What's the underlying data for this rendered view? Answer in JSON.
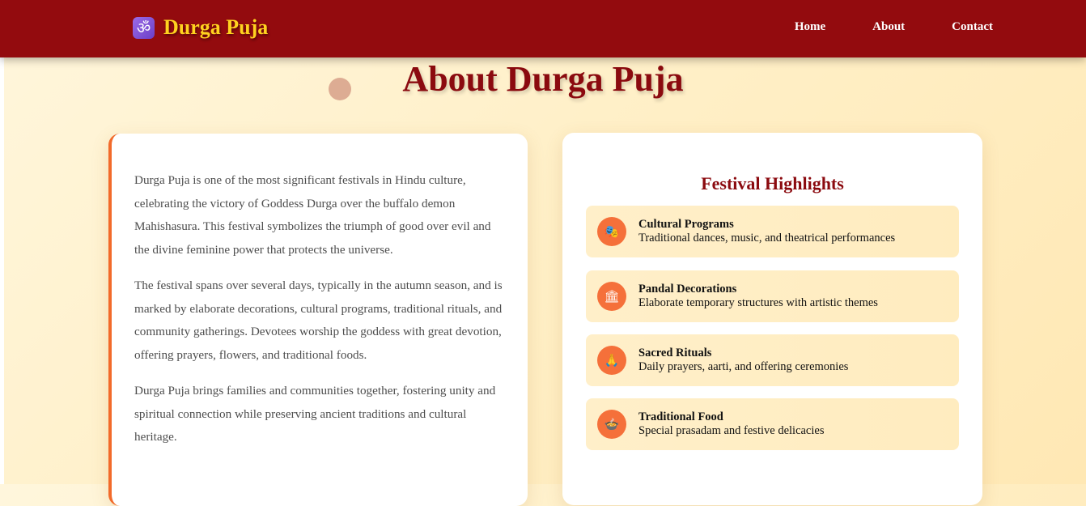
{
  "header": {
    "logo_icon": "om-symbol-icon",
    "logo_glyph": "ॐ",
    "title": "Durga Puja",
    "nav": [
      {
        "label": "Home"
      },
      {
        "label": "About"
      },
      {
        "label": "Contact"
      }
    ],
    "colors": {
      "bar": "#930b0e",
      "title": "#ffd21f"
    }
  },
  "main": {
    "title": "About Durga Puja",
    "paragraphs": [
      "Durga Puja is one of the most significant festivals in Hindu culture, celebrating the victory of Goddess Durga over the buffalo demon Mahishasura. This festival symbolizes the triumph of good over evil and the divine feminine power that protects the universe.",
      "The festival spans over several days, typically in the autumn season, and is marked by elaborate decorations, cultural programs, traditional rituals, and community gatherings. Devotees worship the goddess with great devotion, offering prayers, flowers, and traditional foods.",
      "Durga Puja brings families and communities together, fostering unity and spiritual connection while preserving ancient traditions and cultural heritage."
    ],
    "highlights": {
      "title": "Festival Highlights",
      "items": [
        {
          "icon": "theater-masks-icon",
          "glyph": "🎭",
          "name": "Cultural Programs",
          "desc": "Traditional dances, music, and theatrical performances"
        },
        {
          "icon": "temple-icon",
          "glyph": "🏛",
          "name": "Pandal Decorations",
          "desc": "Elaborate temporary structures with artistic themes"
        },
        {
          "icon": "prayer-icon",
          "glyph": "🙏",
          "name": "Sacred Rituals",
          "desc": "Daily prayers, aarti, and offering ceremonies"
        },
        {
          "icon": "food-bowl-icon",
          "glyph": "🍲",
          "name": "Traditional Food",
          "desc": "Special prasadam and festive delicacies"
        }
      ]
    },
    "colors": {
      "accent": "#f26a2a",
      "heading": "#8b0a0f"
    }
  }
}
